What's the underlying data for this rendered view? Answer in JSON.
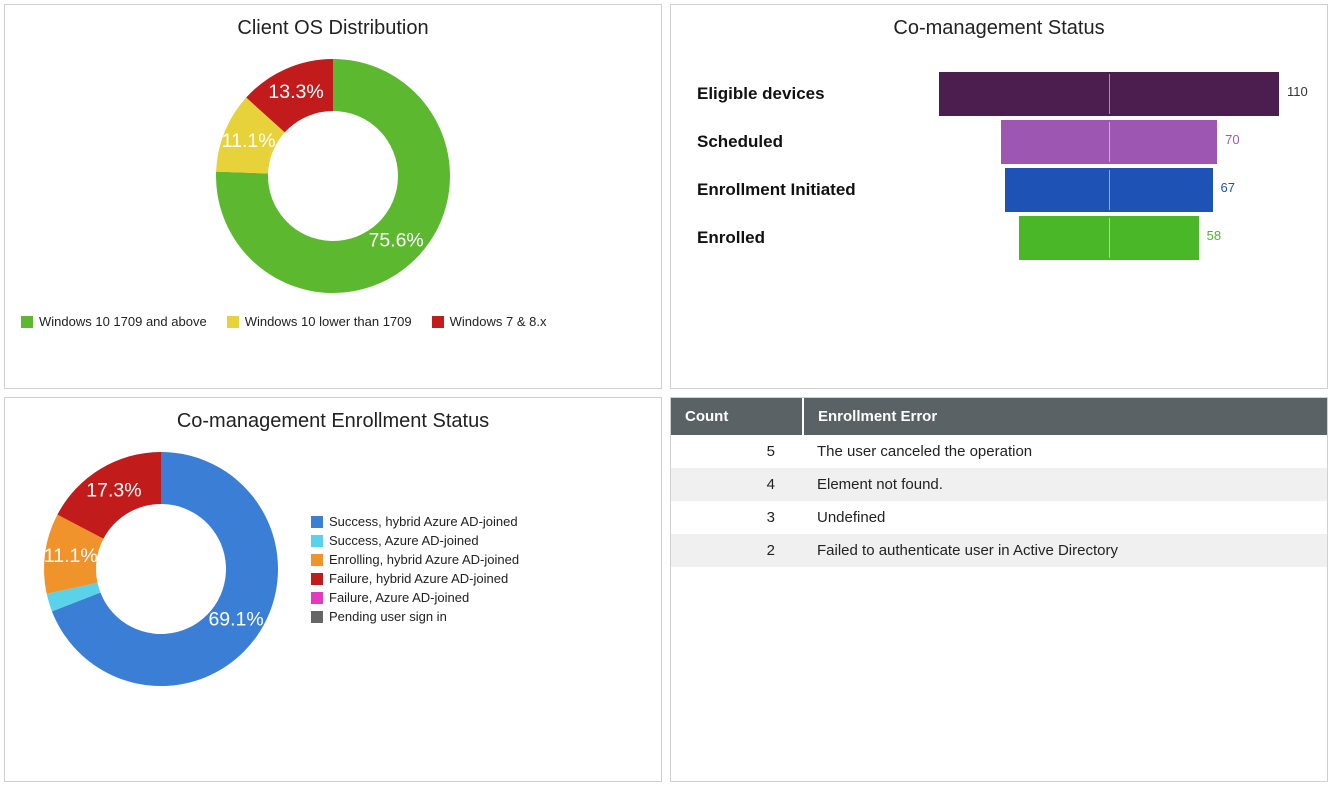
{
  "os_distribution": {
    "title": "Client OS Distribution",
    "slices": [
      {
        "label": "Windows 10 1709 and above",
        "value": 75.6,
        "color": "#5cb82f",
        "display": "75.6%"
      },
      {
        "label": "Windows 10 lower than 1709",
        "value": 11.1,
        "color": "#e8d23a",
        "display": "11.1%"
      },
      {
        "label": "Windows 7 & 8.x",
        "value": 13.3,
        "color": "#c11b1b",
        "display": "13.3%"
      }
    ]
  },
  "comanagement_status": {
    "title": "Co-management Status",
    "stages": [
      {
        "label": "Eligible devices",
        "value": 110,
        "color": "#4c1e50",
        "val_color": "#333333"
      },
      {
        "label": "Scheduled",
        "value": 70,
        "color": "#9d57b3",
        "val_color": "#9d57b3"
      },
      {
        "label": "Enrollment Initiated",
        "value": 67,
        "color": "#1e53b5",
        "val_color": "#1e53b5"
      },
      {
        "label": "Enrolled",
        "value": 58,
        "color": "#49b728",
        "val_color": "#49b728"
      }
    ]
  },
  "enrollment_status": {
    "title": "Co-management Enrollment Status",
    "slices": [
      {
        "label": "Success, hybrid Azure AD-joined",
        "value": 69.1,
        "color": "#3a7fd5",
        "display": "69.1%"
      },
      {
        "label": "Success, Azure AD-joined",
        "value": 2.5,
        "color": "#59d2ea",
        "display": ""
      },
      {
        "label": "Enrolling, hybrid Azure AD-joined",
        "value": 11.1,
        "color": "#f0932b",
        "display": "11.1%"
      },
      {
        "label": "Failure, hybrid Azure AD-joined",
        "value": 17.3,
        "color": "#c11b1b",
        "display": "17.3%"
      },
      {
        "label": "Failure, Azure AD-joined",
        "value": 0,
        "color": "#e23bbd",
        "display": ""
      },
      {
        "label": "Pending user sign in",
        "value": 0,
        "color": "#666666",
        "display": ""
      }
    ]
  },
  "error_table": {
    "headers": {
      "count": "Count",
      "error": "Enrollment Error"
    },
    "rows": [
      {
        "count": 5,
        "error": "The user canceled the operation"
      },
      {
        "count": 4,
        "error": "Element not found."
      },
      {
        "count": 3,
        "error": "Undefined"
      },
      {
        "count": 2,
        "error": "Failed to authenticate user in Active Directory"
      }
    ]
  },
  "chart_data": [
    {
      "type": "pie",
      "title": "Client OS Distribution",
      "categories": [
        "Windows 10 1709 and above",
        "Windows 10 lower than 1709",
        "Windows 7 & 8.x"
      ],
      "values": [
        75.6,
        11.1,
        13.3
      ]
    },
    {
      "type": "bar",
      "title": "Co-management Status",
      "categories": [
        "Eligible devices",
        "Scheduled",
        "Enrollment Initiated",
        "Enrolled"
      ],
      "values": [
        110,
        70,
        67,
        58
      ]
    },
    {
      "type": "pie",
      "title": "Co-management Enrollment Status",
      "categories": [
        "Success, hybrid Azure AD-joined",
        "Success, Azure AD-joined",
        "Enrolling, hybrid Azure AD-joined",
        "Failure, hybrid Azure AD-joined",
        "Failure, Azure AD-joined",
        "Pending user sign in"
      ],
      "values": [
        69.1,
        2.5,
        11.1,
        17.3,
        0,
        0
      ]
    },
    {
      "type": "table",
      "title": "Enrollment Error",
      "columns": [
        "Count",
        "Enrollment Error"
      ],
      "rows": [
        [
          5,
          "The user canceled the operation"
        ],
        [
          4,
          "Element not found."
        ],
        [
          3,
          "Undefined"
        ],
        [
          2,
          "Failed to authenticate user in Active Directory"
        ]
      ]
    }
  ]
}
